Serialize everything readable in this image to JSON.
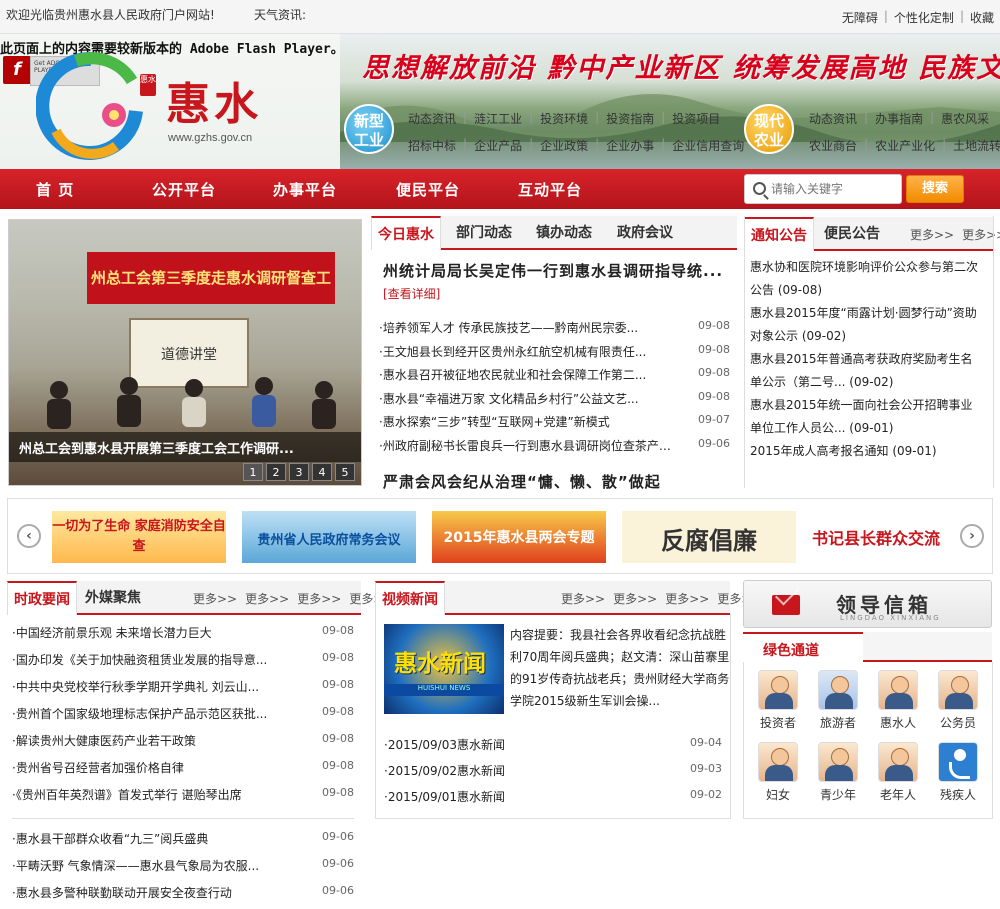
{
  "topbar": {
    "welcome": "欢迎光临贵州惠水县人民政府门户网站!",
    "weather": "天气资讯:",
    "links": [
      "无障碍",
      "个性化定制",
      "收藏"
    ]
  },
  "banner": {
    "flash_notice": "此页面上的内容需要较新版本的 Adobe Flash Player。",
    "flash_box_text": "Get ADOBE FLASH PLAYER",
    "logo_text": "惠水",
    "logo_seal": "惠水",
    "logo_url": "www.gzhs.gov.cn",
    "slogan": "思想解放前沿  黔中产业新区  统筹发展高地  民族文化重镇",
    "badge_industry": "新型\n工业",
    "badge_agri": "现代\n农业",
    "industry_row1": [
      "动态资讯",
      "涟江工业",
      "投资环境",
      "投资指南",
      "投资项目"
    ],
    "industry_row2": [
      "招标中标",
      "企业产品",
      "企业政策",
      "企业办事",
      "企业信用查询"
    ],
    "agri_row1": [
      "动态资讯",
      "办事指南",
      "惠农风采"
    ],
    "agri_row2": [
      "农业商台",
      "农业产业化",
      "土地流转"
    ]
  },
  "nav": {
    "items": [
      "首  页",
      "公开平台",
      "办事平台",
      "便民平台",
      "互动平台"
    ],
    "search_placeholder": "请输入关键字",
    "search_button": "搜索"
  },
  "slideshow": {
    "image_banner": "州总工会第三季度走惠水调研督查工作会",
    "image_board": "道德讲堂",
    "caption": "州总工会到惠水县开展第三季度工会工作调研...",
    "pages": [
      "1",
      "2",
      "3",
      "4",
      "5"
    ]
  },
  "today": {
    "tabs": [
      "今日惠水",
      "部门动态",
      "镇办动态",
      "政府会议"
    ],
    "headline": "州统计局局长吴定伟一行到惠水县调研指导统...",
    "detail": "[查看详细]",
    "items": [
      {
        "title": "培养领军人才  传承民族技艺——黔南州民宗委...",
        "date": "09-08"
      },
      {
        "title": "王文旭县长到经开区贵州永红航空机械有限责任...",
        "date": "09-08"
      },
      {
        "title": "惠水县召开被征地农民就业和社会保障工作第二...",
        "date": "09-08"
      },
      {
        "title": "惠水县“幸福进万家  文化精品乡村行”公益文艺...",
        "date": "09-08"
      },
      {
        "title": "惠水探索“三步”转型“互联网+党建”新模式",
        "date": "09-07"
      },
      {
        "title": "州政府副秘书长雷良兵一行到惠水县调研岗位查茶产业...",
        "date": "09-06"
      }
    ],
    "headline2": "严肃会风会纪从治理“慵、懒、散”做起"
  },
  "notices": {
    "tabs": [
      "通知公告",
      "便民公告"
    ],
    "more": [
      "更多>>",
      "更多>>"
    ],
    "items": [
      "惠水协和医院环境影响评价公众参与第二次公告 (09-08)",
      "惠水县2015年度“雨露计划·圆梦行动”资助对象公示 (09-02)",
      "惠水县2015年普通高考获政府奖励考生名单公示（第二号... (09-02)",
      "惠水县2015年统一面向社会公开招聘事业单位工作人员公... (09-01)",
      "2015年成人高考报名通知 (09-01)"
    ]
  },
  "carousel": {
    "prev": "‹",
    "next": "›",
    "promos": [
      "一切为了生命 家庭消防安全自查",
      "贵州省人民政府常务会议",
      "2015年惠水县两会专题",
      "反腐倡廉",
      "书记县长群众交流"
    ]
  },
  "politics": {
    "tabs": [
      "时政要闻",
      "外媒聚焦"
    ],
    "more": [
      "更多>>",
      "更多>>",
      "更多>>",
      "更多>>"
    ],
    "items": [
      {
        "title": "中国经济前景乐观  未来增长潜力巨大",
        "date": "09-08"
      },
      {
        "title": "国办印发《关于加快融资租赁业发展的指导意...",
        "date": "09-08"
      },
      {
        "title": "中共中央党校举行秋季学期开学典礼  刘云山...",
        "date": "09-08"
      },
      {
        "title": "贵州首个国家级地理标志保护产品示范区获批...",
        "date": "09-08"
      },
      {
        "title": "解读贵州大健康医药产业若干政策",
        "date": "09-08"
      },
      {
        "title": "贵州省号召经营者加强价格自律",
        "date": "09-08"
      },
      {
        "title": "《贵州百年英烈谱》首发式举行  谌贻琴出席",
        "date": "09-08"
      }
    ],
    "items2": [
      {
        "title": "惠水县干部群众收看“九三”阅兵盛典",
        "date": "09-06"
      },
      {
        "title": "平畴沃野  气象情深——惠水县气象局为农服...",
        "date": "09-06"
      },
      {
        "title": "惠水县多警种联勤联动开展安全夜查行动",
        "date": "09-06"
      }
    ]
  },
  "video": {
    "tab": "视频新闻",
    "more": [
      "更多>>",
      "更多>>",
      "更多>>",
      "更多>>"
    ],
    "thumb_title": "惠水新闻",
    "thumb_sub": "HUISHUI NEWS",
    "summary": "内容提要：我县社会各界收看纪念抗战胜利70周年阅兵盛典；赵文清：深山苗寨里的91岁传奇抗战老兵；贵州财经大学商务学院2015级新生军训会操...",
    "items": [
      {
        "title": "2015/09/03惠水新闻",
        "date": "09-04"
      },
      {
        "title": "2015/09/02惠水新闻",
        "date": "09-03"
      },
      {
        "title": "2015/09/01惠水新闻",
        "date": "09-02"
      }
    ]
  },
  "mailbox": {
    "title": "领导信箱",
    "subtitle": "LINGDAO XINXIANG"
  },
  "green": {
    "title": "绿色通道",
    "channels": [
      "投资者",
      "旅游者",
      "惠水人",
      "公务员",
      "妇女",
      "青少年",
      "老年人",
      "残疾人"
    ]
  },
  "colors": {
    "brand_red": "#c8161d",
    "nav_red": "#b3141b",
    "search_orange": "#f28a00"
  }
}
